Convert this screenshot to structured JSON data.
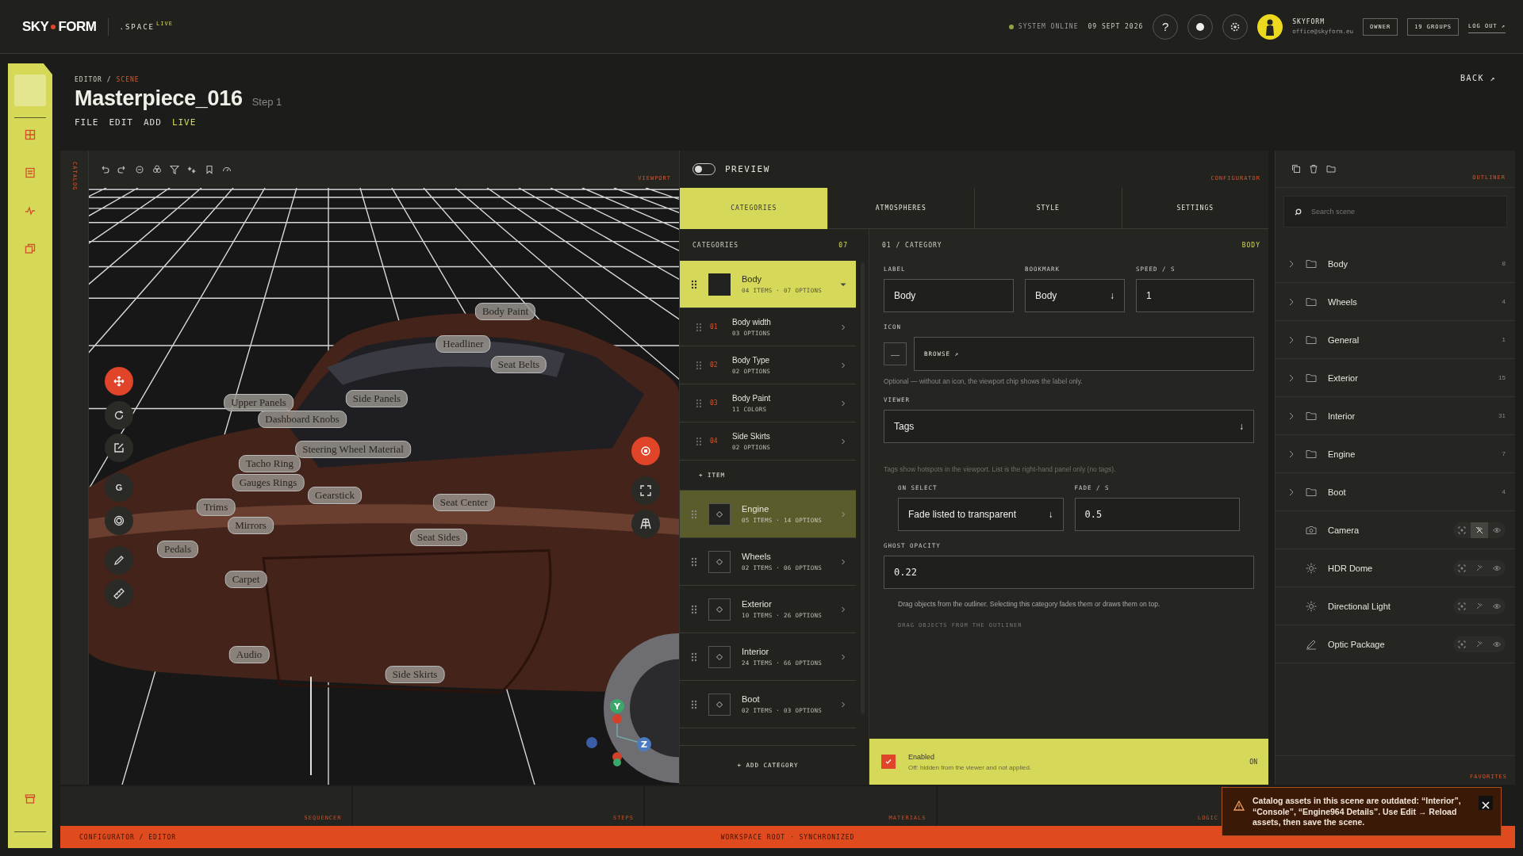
{
  "topbar": {
    "logo_left": "SKY",
    "logo_right": "FORM",
    "workspace": ".SPACE",
    "workspace_badge": "LIVE",
    "status": "SYSTEM ONLINE",
    "online": true,
    "date": "09 SEPT 2026",
    "help": "?",
    "user_name": "SKYFORM",
    "user_email": "office@skyform.eu",
    "buttons": [
      "OWNER",
      "19 GROUPS",
      "LOG OUT ↗"
    ]
  },
  "header": {
    "path": "EDITOR /",
    "current": "SCENE",
    "title": "Masterpiece_016",
    "subtitle": "Step 1",
    "back": "BACK ↗",
    "menu": [
      {
        "label": "FILE",
        "selected": false
      },
      {
        "label": "EDIT",
        "selected": false
      },
      {
        "label": "ADD",
        "selected": false
      },
      {
        "label": "LIVE",
        "selected": true
      }
    ]
  },
  "viewport": {
    "side_label": "CATALOG",
    "label": "VIEWPORT",
    "gizmo_axes": [
      "Y",
      "Z"
    ],
    "hotspots": [
      "Body Paint",
      "Headliner",
      "Seat Belts",
      "Upper Panels",
      "Side Panels",
      "Dashboard Knobs",
      "Steering Wheel Material",
      "Tacho Ring",
      "Gauges Rings",
      "Gearstick",
      "Seat Center",
      "Trims",
      "Mirrors",
      "Seat Sides",
      "Pedals",
      "Carpet",
      "Audio",
      "Side Skirts"
    ],
    "left_tools": [
      {
        "kind": "move",
        "selected": true
      },
      {
        "kind": "rotate",
        "selected": false
      },
      {
        "kind": "edit",
        "selected": false
      },
      {
        "kind": "letter",
        "label": "G",
        "selected": false
      },
      {
        "kind": "target",
        "selected": false
      },
      {
        "kind": "pen",
        "selected": false
      },
      {
        "kind": "ruler",
        "selected": false
      }
    ],
    "right_tools": [
      {
        "kind": "focus",
        "selected": true
      },
      {
        "kind": "expand",
        "selected": false
      },
      {
        "kind": "grid",
        "selected": false
      }
    ]
  },
  "configurator": {
    "preview": {
      "label": "PREVIEW",
      "on": false
    },
    "label": "CONFIGURATOR",
    "tabs": [
      {
        "label": "CATEGORIES",
        "selected": true
      },
      {
        "label": "ATMOSPHERES",
        "selected": false
      },
      {
        "label": "STYLE",
        "selected": false
      },
      {
        "label": "SETTINGS",
        "selected": false
      }
    ],
    "list_title": "CATEGORIES",
    "list_count": "07",
    "add_category": "+ ADD CATEGORY",
    "categories": [
      {
        "name": "Body",
        "meta": "04 ITEMS · 07 OPTIONS",
        "selected": true,
        "highlighted": false,
        "expanded": true,
        "has_icon": false,
        "add_item": "+ ITEM",
        "children": [
          {
            "index": "01",
            "name": "Body width",
            "meta": "03 OPTIONS"
          },
          {
            "index": "02",
            "name": "Body Type",
            "meta": "02 OPTIONS"
          },
          {
            "index": "03",
            "name": "Body Paint",
            "meta": "11 COLORS"
          },
          {
            "index": "04",
            "name": "Side Skirts",
            "meta": "02 OPTIONS"
          }
        ]
      },
      {
        "name": "Engine",
        "meta": "05 ITEMS · 14 OPTIONS",
        "selected": false,
        "highlighted": true,
        "expanded": false,
        "has_icon": true
      },
      {
        "name": "Wheels",
        "meta": "02 ITEMS · 06 OPTIONS",
        "selected": false,
        "highlighted": false,
        "expanded": false,
        "has_icon": true
      },
      {
        "name": "Exterior",
        "meta": "10 ITEMS · 26 OPTIONS",
        "selected": false,
        "highlighted": false,
        "expanded": false,
        "has_icon": true
      },
      {
        "name": "Interior",
        "meta": "24 ITEMS · 66 OPTIONS",
        "selected": false,
        "highlighted": false,
        "expanded": false,
        "has_icon": true
      },
      {
        "name": "Boot",
        "meta": "02 ITEMS · 03 OPTIONS",
        "selected": false,
        "highlighted": false,
        "expanded": false,
        "has_icon": true
      }
    ],
    "detail": {
      "index": "01 / CATEGORY",
      "name": "BODY",
      "label": {
        "title": "LABEL",
        "value": "Body"
      },
      "bookmark": {
        "title": "BOOKMARK",
        "value": "Body",
        "caret": "↓"
      },
      "speed": {
        "title": "SPEED / S",
        "value": "1"
      },
      "icon": {
        "title": "ICON",
        "empty": "—",
        "browse": "BROWSE ↗",
        "hint": "Optional — without an icon, the viewport chip shows the label only."
      },
      "viewer": {
        "title": "VIEWER",
        "value": "Tags",
        "caret": "↓",
        "hint": "Tags show hotspots in the viewport. List is the right-hand panel only (no tags)."
      },
      "on_select": {
        "title": "ON SELECT",
        "value": "Fade listed to transparent",
        "caret": "↓"
      },
      "fade": {
        "title": "FADE / S",
        "value": "0.5"
      },
      "ghost_opacity": {
        "title": "GHOST OPACITY",
        "value": "0.22"
      },
      "note": "Drag objects from the outliner. Selecting this category fades them or draws them on top.",
      "drop_hint": "DRAG OBJECTS FROM THE OUTLINER",
      "enabled": {
        "checked": true,
        "label": "Enabled",
        "hint": "Off: hidden from the viewer and not applied.",
        "state": "ON"
      }
    }
  },
  "outliner": {
    "label": "OUTLINER",
    "search_placeholder": "Search scene",
    "favorites": "FAVORITES",
    "folders": [
      {
        "name": "Body",
        "count": "8"
      },
      {
        "name": "Wheels",
        "count": "4"
      },
      {
        "name": "General",
        "count": "1"
      },
      {
        "name": "Exterior",
        "count": "15"
      },
      {
        "name": "Interior",
        "count": "31"
      },
      {
        "name": "Engine",
        "count": "7"
      },
      {
        "name": "Boot",
        "count": "4"
      }
    ],
    "objects": [
      {
        "name": "Camera",
        "kind": "camera",
        "pinned": true
      },
      {
        "name": "HDR Dome",
        "kind": "light",
        "pinned": false
      },
      {
        "name": "Directional Light",
        "kind": "light",
        "pinned": false
      },
      {
        "name": "Optic Package",
        "kind": "pencil",
        "pinned": false
      }
    ]
  },
  "bottom_tabs": [
    "SEQUENCER",
    "STEPS",
    "MATERIALS",
    "LOGIC"
  ],
  "status_bar": {
    "left": "CONFIGURATOR / EDITOR",
    "center": "WORKSPACE ROOT · SYNCHRONIZED"
  },
  "toast": {
    "text": "Catalog assets in this scene are outdated: “Interior”, “Console”, “Engine964 Details”. Use Edit → Reload assets, then save the scene."
  }
}
